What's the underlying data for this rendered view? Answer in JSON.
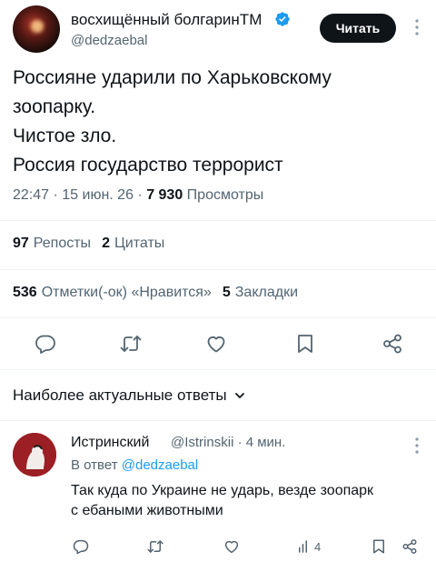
{
  "author": {
    "display_name": "восхищённый болгаринTM",
    "handle": "@dedzaebal",
    "follow_label": "Читать"
  },
  "tweet": {
    "lines": [
      "Россияне ударили по Харьковскому",
      "зоопарку.",
      "Чистое зло.",
      "Россия государство террорист"
    ],
    "time": "22:47 · 15 июн. 26 · ",
    "views_count": "7 930",
    "views_label": " Просмотры"
  },
  "stats_row1": {
    "reposts_count": "97",
    "reposts_label": "Репосты",
    "quotes_count": "2",
    "quotes_label": "Цитаты"
  },
  "stats_row2": {
    "likes_count": "536",
    "likes_label": "Отметки(-ок) «Нравится»",
    "bookmarks_count": "5",
    "bookmarks_label": "Закладки"
  },
  "sort": {
    "label": "Наиболее актуальные ответы"
  },
  "reply": {
    "name": "Истринский",
    "handle_time": "@Istrinskii · 4 мин.",
    "reply_to_prefix": "В ответ ",
    "reply_to_handle": "@dedzaebal",
    "lines": [
      "Так куда по Украине не ударь, везде зоопарк",
      "с ебаными животными"
    ],
    "views_count": "4"
  },
  "colors": {
    "primary_text": "#0f1419",
    "secondary_text": "#536471",
    "accent": "#1d9bf0",
    "divider": "#eff3f4"
  }
}
